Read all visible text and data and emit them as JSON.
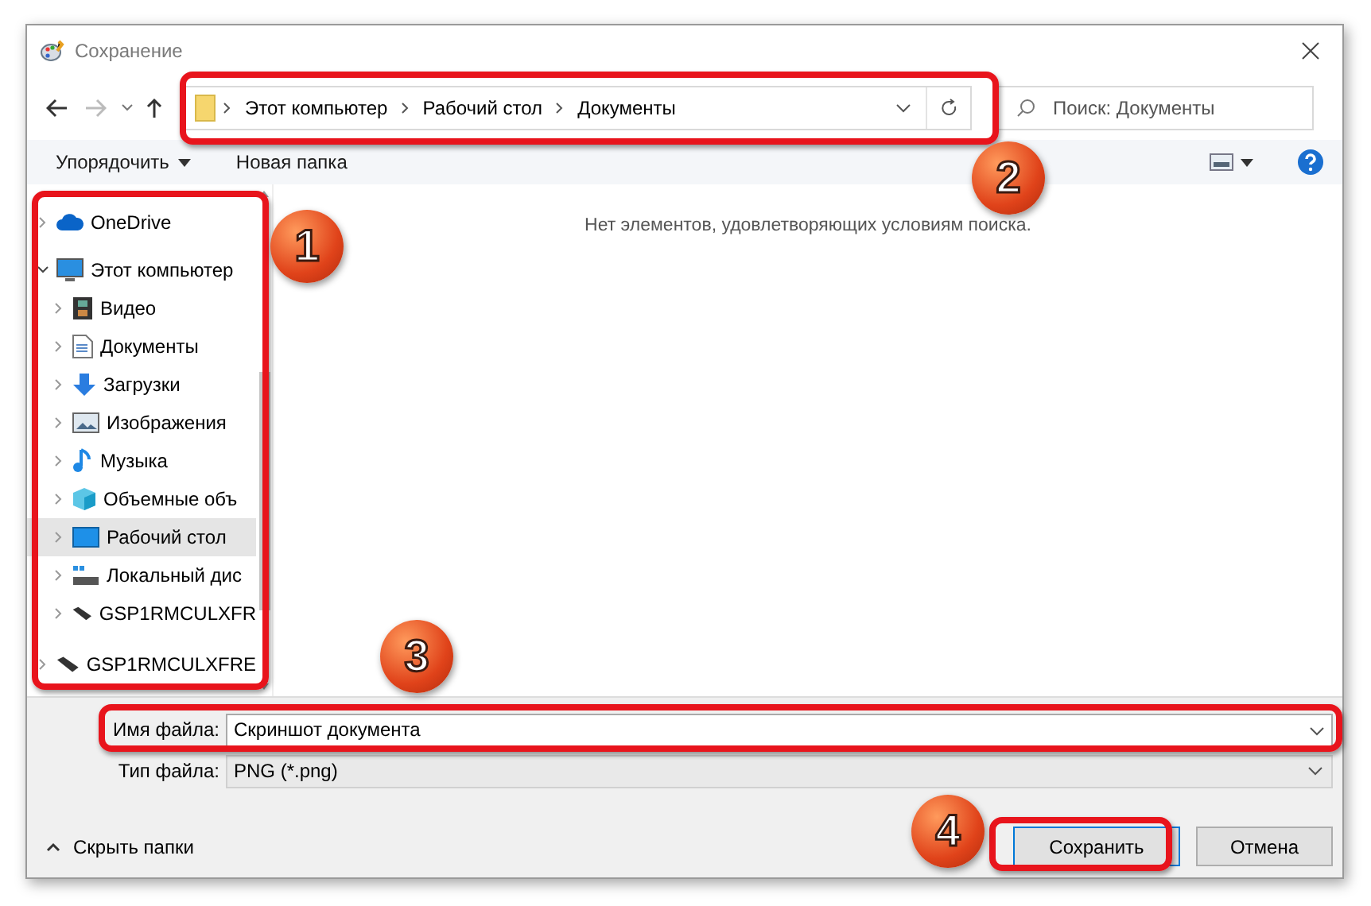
{
  "window": {
    "title": "Сохранение"
  },
  "address": {
    "path": [
      "Этот компьютер",
      "Рабочий стол",
      "Документы"
    ]
  },
  "search": {
    "placeholder": "Поиск: Документы"
  },
  "toolbar": {
    "organize": "Упорядочить",
    "new_folder": "Новая папка"
  },
  "sidebar": {
    "items": [
      {
        "label": "OneDrive",
        "kind": "cloud",
        "expanded": false,
        "selected": false
      },
      {
        "label": "Этот компьютер",
        "kind": "computer",
        "expanded": true,
        "selected": false,
        "children": [
          {
            "label": "Видео",
            "kind": "video",
            "expanded": false,
            "selected": false
          },
          {
            "label": "Документы",
            "kind": "document",
            "expanded": false,
            "selected": false
          },
          {
            "label": "Загрузки",
            "kind": "download",
            "expanded": false,
            "selected": false
          },
          {
            "label": "Изображения",
            "kind": "image",
            "expanded": false,
            "selected": false
          },
          {
            "label": "Музыка",
            "kind": "music",
            "expanded": false,
            "selected": false
          },
          {
            "label": "Объемные объ",
            "kind": "cube",
            "expanded": false,
            "selected": false
          },
          {
            "label": "Рабочий стол",
            "kind": "desktop",
            "expanded": false,
            "selected": true
          },
          {
            "label": "Локальный дис",
            "kind": "disk",
            "expanded": false,
            "selected": false
          },
          {
            "label": "GSP1RMCULXFR",
            "kind": "drive",
            "expanded": false,
            "selected": false
          }
        ]
      },
      {
        "label": "GSP1RMCULXFRE",
        "kind": "drive",
        "expanded": false,
        "selected": false
      }
    ]
  },
  "content": {
    "empty_message": "Нет элементов, удовлетворяющих условиям поиска."
  },
  "file_name": {
    "label": "Имя файла:",
    "value": "Скриншот документа"
  },
  "file_type": {
    "label": "Тип файла:",
    "value": "PNG (*.png)"
  },
  "hide_folders": "Скрыть папки",
  "buttons": [
    {
      "label": "Сохранить",
      "kind": "primary"
    },
    {
      "label": "Отмена",
      "kind": "secondary"
    }
  ],
  "annotations": [
    {
      "number": "1"
    },
    {
      "number": "2"
    },
    {
      "number": "3"
    },
    {
      "number": "4"
    }
  ]
}
